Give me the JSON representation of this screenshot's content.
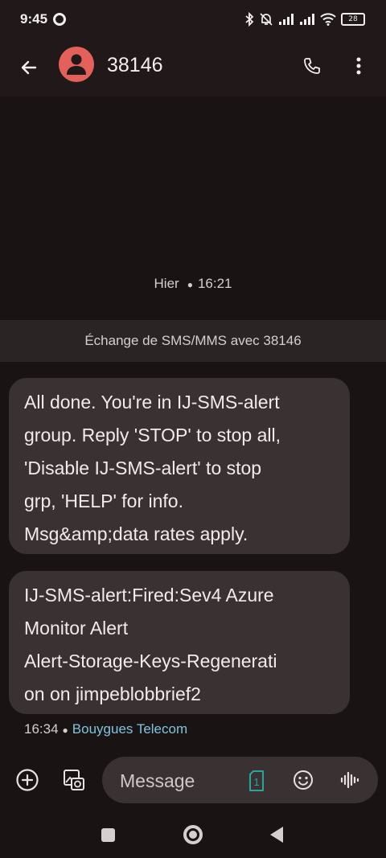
{
  "status_bar": {
    "time": "9:45",
    "battery": "28"
  },
  "header": {
    "contact": "38146",
    "avatar_color": "#e3605b"
  },
  "conversation": {
    "date_label": "Hier",
    "date_time": "16:21",
    "exchange_banner": "Échange de SMS/MMS avec 38146",
    "messages": [
      {
        "text": "All done. You're in IJ-SMS-alert\ngroup. Reply 'STOP' to stop all,\n'Disable IJ-SMS-alert' to stop\ngrp, 'HELP' for info.\nMsg&amp;data rates apply."
      },
      {
        "text": "IJ-SMS-alert:Fired:Sev4 Azure\nMonitor Alert\nAlert-Storage-Keys-Regenerati\non on jimpeblobbrief2"
      }
    ],
    "last_time": "16:34",
    "carrier": "Bouygues Telecom",
    "carrier_color": "#7fc4dd"
  },
  "compose": {
    "placeholder": "Message",
    "sim_number": "1"
  },
  "icons": {
    "back": "arrow-back-icon",
    "call": "phone-icon",
    "more": "more-vert-icon",
    "add": "add-circle-icon",
    "gallery": "gallery-icon",
    "sim": "sim-card-icon",
    "emoji": "emoji-icon",
    "voice": "voice-waveform-icon"
  }
}
